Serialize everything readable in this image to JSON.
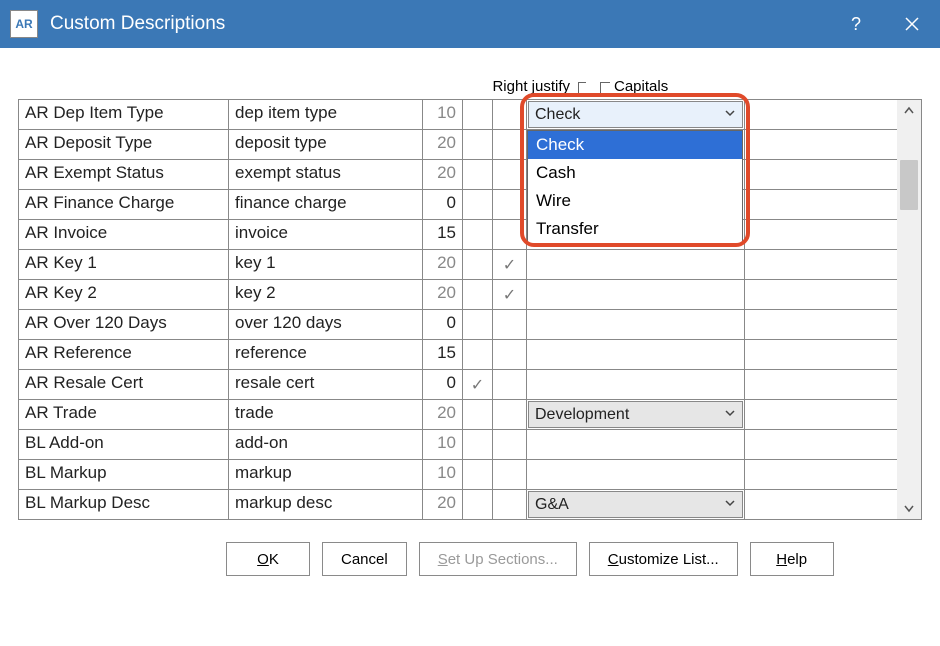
{
  "window": {
    "icon_text": "AR",
    "title": "Custom Descriptions"
  },
  "headers": {
    "right_justify": "Right justify",
    "capitals": "Capitals"
  },
  "rows": [
    {
      "label": "AR Dep Item Type",
      "desc": "dep item type",
      "num": "10",
      "num_dim": true,
      "rj": false,
      "cap": false,
      "combo": "Check",
      "combo_open": true
    },
    {
      "label": "AR Deposit Type",
      "desc": "deposit type",
      "num": "20",
      "num_dim": true,
      "rj": false,
      "cap": false
    },
    {
      "label": "AR Exempt Status",
      "desc": "exempt status",
      "num": "20",
      "num_dim": true,
      "rj": false,
      "cap": false
    },
    {
      "label": "AR Finance Charge",
      "desc": "finance charge",
      "num": "0",
      "num_dim": false,
      "rj": false,
      "cap": false
    },
    {
      "label": "AR Invoice",
      "desc": "invoice",
      "num": "15",
      "num_dim": false,
      "rj": false,
      "cap": false
    },
    {
      "label": "AR Key 1",
      "desc": "key 1",
      "num": "20",
      "num_dim": true,
      "rj": false,
      "cap": true
    },
    {
      "label": "AR Key 2",
      "desc": "key 2",
      "num": "20",
      "num_dim": true,
      "rj": false,
      "cap": true
    },
    {
      "label": "AR Over 120 Days",
      "desc": "over 120 days",
      "num": "0",
      "num_dim": false,
      "rj": false,
      "cap": false
    },
    {
      "label": "AR Reference",
      "desc": "reference",
      "num": "15",
      "num_dim": false,
      "rj": false,
      "cap": false
    },
    {
      "label": "AR Resale Cert",
      "desc": "resale cert",
      "num": "0",
      "num_dim": false,
      "rj": true,
      "cap": false
    },
    {
      "label": "AR Trade",
      "desc": "trade",
      "num": "20",
      "num_dim": true,
      "rj": false,
      "cap": false,
      "combo": "Development"
    },
    {
      "label": "BL Add-on",
      "desc": "add-on",
      "num": "10",
      "num_dim": true,
      "rj": false,
      "cap": false
    },
    {
      "label": "BL Markup",
      "desc": "markup",
      "num": "10",
      "num_dim": true,
      "rj": false,
      "cap": false
    },
    {
      "label": "BL Markup Desc",
      "desc": "markup desc",
      "num": "20",
      "num_dim": true,
      "rj": false,
      "cap": false,
      "combo": "G&A"
    }
  ],
  "dropdown": {
    "options": [
      "Check",
      "Cash",
      "Wire",
      "Transfer"
    ],
    "selected_index": 0
  },
  "buttons": {
    "ok_u": "O",
    "ok_rest": "K",
    "cancel": "Cancel",
    "setup_u": "S",
    "setup_rest": "et Up Sections...",
    "customize_u": "C",
    "customize_rest": "ustomize List...",
    "help_u": "H",
    "help_rest": "elp"
  }
}
